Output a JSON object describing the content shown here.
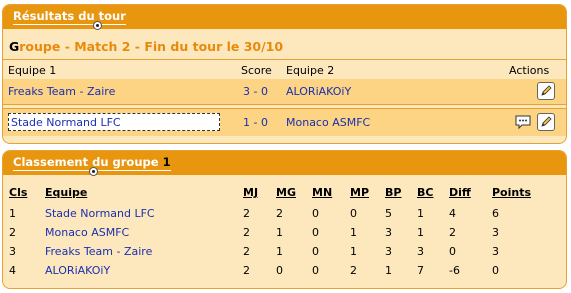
{
  "round": {
    "header": "Résultats du tour",
    "title_first": "G",
    "title_rest": "roupe - Match 2 - Fin du tour le 30/10",
    "columns": {
      "team1": "Equipe 1",
      "score": "Score",
      "team2": "Equipe 2",
      "actions": "Actions"
    },
    "matches": [
      {
        "team1": "Freaks Team - Zaire",
        "score": "3 - 0",
        "team2": "ALORiAKOiY"
      },
      {
        "team1": "Stade Normand LFC",
        "score": "1 - 0",
        "team2": "Monaco ASMFC"
      }
    ]
  },
  "standings": {
    "header_text": "Classement du groupe",
    "header_num": "1",
    "columns": {
      "cls": "Cls",
      "team": "Equipe",
      "mj": "MJ",
      "mg": "MG",
      "mn": "MN",
      "mp": "MP",
      "bp": "BP",
      "bc": "BC",
      "diff": "Diff",
      "points": "Points"
    },
    "rows": [
      {
        "cls": "1",
        "team": "Stade Normand LFC",
        "mj": "2",
        "mg": "2",
        "mn": "0",
        "mp": "0",
        "bp": "5",
        "bc": "1",
        "diff": "4",
        "points": "6"
      },
      {
        "cls": "2",
        "team": "Monaco ASMFC",
        "mj": "2",
        "mg": "1",
        "mn": "0",
        "mp": "1",
        "bp": "3",
        "bc": "1",
        "diff": "2",
        "points": "3"
      },
      {
        "cls": "3",
        "team": "Freaks Team - Zaire",
        "mj": "2",
        "mg": "1",
        "mn": "0",
        "mp": "1",
        "bp": "3",
        "bc": "3",
        "diff": "0",
        "points": "3"
      },
      {
        "cls": "4",
        "team": "ALORiAKOiY",
        "mj": "2",
        "mg": "0",
        "mn": "0",
        "mp": "2",
        "bp": "1",
        "bc": "7",
        "diff": "-6",
        "points": "0"
      }
    ]
  },
  "icons": {
    "edit": "pencil-icon",
    "comment": "speech-bubble-icon",
    "ball": "football-icon"
  },
  "colors": {
    "header_bg": "#e8960f",
    "panel_bg": "#fde8bd",
    "row_bg": "#fcd483",
    "link": "#1a2fb0",
    "title": "#e88a0c"
  }
}
